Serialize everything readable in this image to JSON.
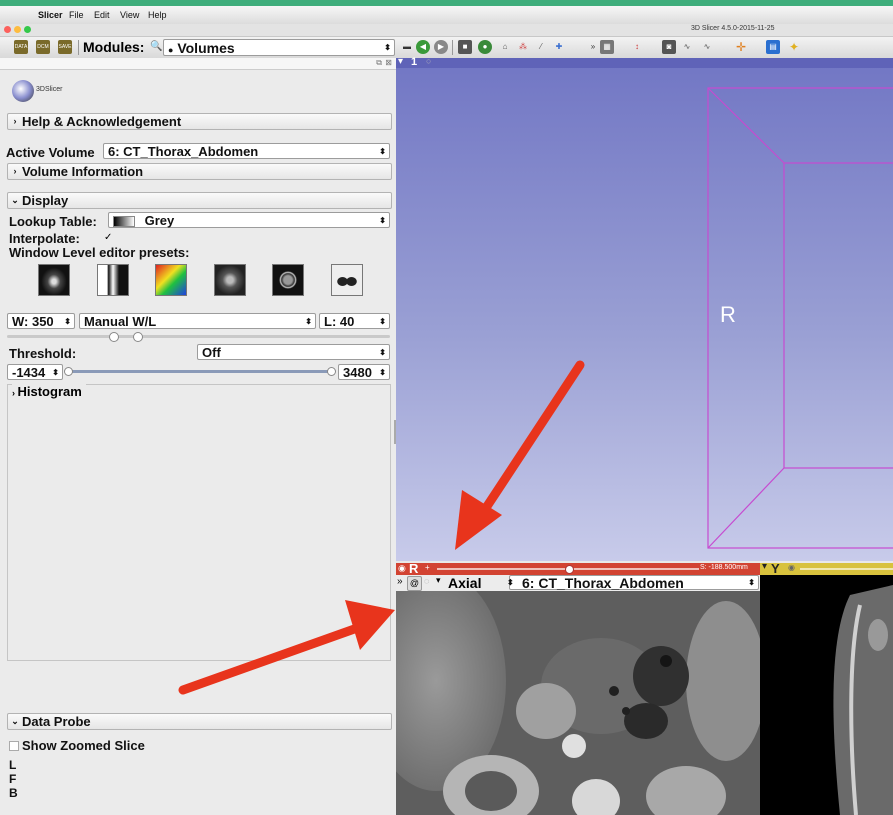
{
  "menubar": {
    "app": "Slicer",
    "items": [
      "File",
      "Edit",
      "View",
      "Help"
    ]
  },
  "window": {
    "title": "3D Slicer 4.5.0-2015-11-25"
  },
  "toolbar": {
    "modules_label": "Modules:",
    "module_selected": "Volumes",
    "data_icon_labels": [
      "DATA",
      "DCM",
      "SAVE"
    ]
  },
  "left_panel": {
    "logo_text": "3DSlicer",
    "help_section": "Help & Acknowledgement",
    "active_volume_label": "Active Volume",
    "active_volume_value": "6: CT_Thorax_Abdomen",
    "volume_info_section": "Volume Information",
    "display_section": "Display",
    "lookup_table_label": "Lookup Table:",
    "lookup_table_value": "Grey",
    "interpolate_label": "Interpolate:",
    "interpolate_checked": "✓",
    "wl_presets_label": "Window Level editor presets:",
    "window_value": "W: 350",
    "wl_mode": "Manual W/L",
    "level_value": "L: 40",
    "threshold_label": "Threshold:",
    "threshold_value": "Off",
    "range_min": "-1434",
    "range_max": "3480",
    "histogram_section": "Histogram",
    "data_probe_section": "Data Probe",
    "show_zoomed_slice": "Show Zoomed Slice",
    "probe_lines": [
      "L",
      "F",
      "B"
    ]
  },
  "view3d": {
    "label": "1",
    "orientation_marker": "R"
  },
  "red_slice": {
    "label": "R",
    "offset": "S: -188.500mm",
    "orientation": "Axial",
    "volume": "6: CT_Thorax_Abdomen"
  },
  "yellow_slice": {
    "label": "Y"
  },
  "colors": {
    "annotation_arrow": "#e8341c",
    "red_slice": "#d24332",
    "yellow_slice": "#d8c23d",
    "view3d_bg": "#8a8fcf",
    "bbox": "#c64bd0"
  }
}
